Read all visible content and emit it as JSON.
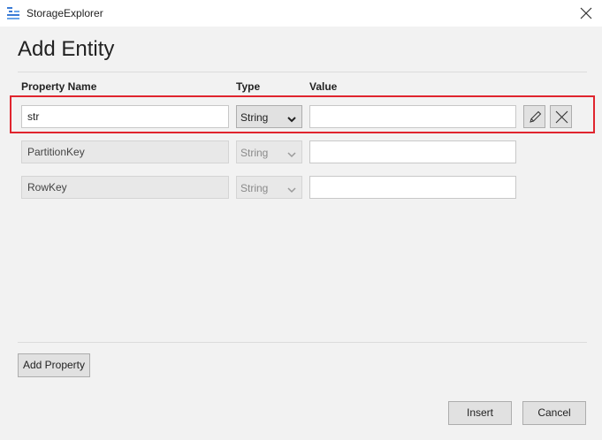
{
  "window": {
    "title": "StorageExplorer"
  },
  "dialog": {
    "title": "Add Entity",
    "columns": {
      "property_name": "Property Name",
      "type": "Type",
      "value": "Value"
    },
    "rows": [
      {
        "name": "str",
        "type": "String",
        "value": "",
        "editable": true
      },
      {
        "name": "PartitionKey",
        "type": "String",
        "value": "",
        "editable": false
      },
      {
        "name": "RowKey",
        "type": "String",
        "value": "",
        "editable": false
      }
    ],
    "add_property_label": "Add Property",
    "insert_label": "Insert",
    "cancel_label": "Cancel"
  },
  "colors": {
    "highlight": "#e0252e",
    "window_bg": "#f2f2f2",
    "button_bg": "#e1e1e1"
  },
  "icons": {
    "app": "storage-explorer-icon",
    "close": "close-icon",
    "edit": "pencil-icon",
    "delete": "delete-x-icon",
    "dropdown": "chevron-down-icon"
  }
}
